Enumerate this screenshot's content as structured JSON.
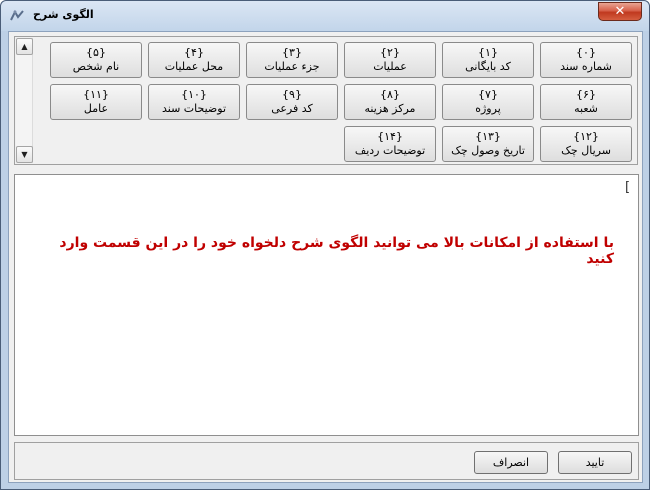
{
  "window": {
    "title": "الگوی شرح",
    "close_label": "✕"
  },
  "scroll": {
    "up": "▲",
    "down": "▼"
  },
  "tokens": [
    {
      "code": "{۰}",
      "label": "شماره سند"
    },
    {
      "code": "{۱}",
      "label": "کد بایگانی"
    },
    {
      "code": "{۲}",
      "label": "عملیات"
    },
    {
      "code": "{۳}",
      "label": "جزء عملیات"
    },
    {
      "code": "{۴}",
      "label": "محل عملیات"
    },
    {
      "code": "{۵}",
      "label": "نام شخص"
    },
    {
      "code": "{۶}",
      "label": "شعبه"
    },
    {
      "code": "{۷}",
      "label": "پروژه"
    },
    {
      "code": "{۸}",
      "label": "مرکز هزینه"
    },
    {
      "code": "{۹}",
      "label": "کد فرعی"
    },
    {
      "code": "{۱۰}",
      "label": "توضیحات سند"
    },
    {
      "code": "{۱۱}",
      "label": "عامل"
    },
    {
      "code": "{۱۲}",
      "label": "سریال چک"
    },
    {
      "code": "{۱۳}",
      "label": "تاریخ وصول چک"
    },
    {
      "code": "{۱۴}",
      "label": "توضیحات ردیف"
    }
  ],
  "editor": {
    "cursor": "[",
    "hint": "با استفاده از امکانات بالا می توانید الگوی شرح دلخواه خود را در این قسمت وارد کنید"
  },
  "footer": {
    "confirm": "تایید",
    "cancel": "انصراف"
  },
  "colors": {
    "hint": "#c00000",
    "frame": "#bdd0e6",
    "close": "#c0391f"
  }
}
